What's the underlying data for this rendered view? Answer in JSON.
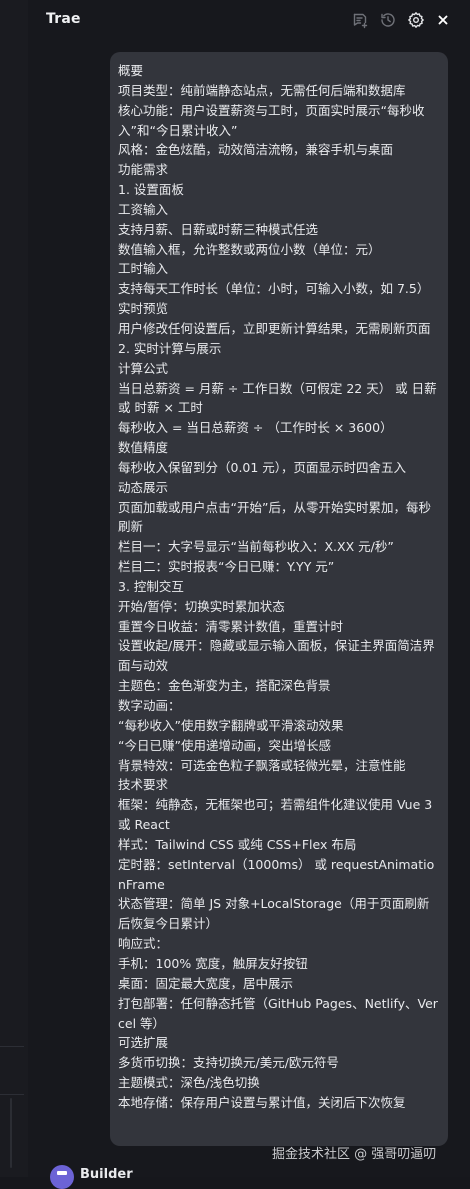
{
  "header": {
    "title": "Trae",
    "icons": [
      "add-chat-icon",
      "history-icon",
      "gear-icon",
      "close-icon"
    ]
  },
  "message": {
    "lines": [
      "概要",
      "项目类型：纯前端静态站点，无需任何后端和数据库",
      "核心功能：用户设置薪资与工时，页面实时展示“每秒收入”和“今日累计收入”",
      "风格：金色炫酷，动效简洁流畅，兼容手机与桌面",
      "功能需求",
      "1. 设置面板",
      "工资输入",
      "支持月薪、日薪或时薪三种模式任选",
      "数值输入框，允许整数或两位小数（单位：元）",
      "工时输入",
      "支持每天工作时长（单位：小时，可输入小数，如 7.5）",
      "实时预览",
      "用户修改任何设置后，立即更新计算结果，无需刷新页面",
      "2. 实时计算与展示",
      "计算公式",
      "当日总薪资 = 月薪 ÷ 工作日数（可假定 22 天） 或  日薪 或  时薪 × 工时",
      "每秒收入 = 当日总薪资 ÷ （工作时长 × 3600）",
      "数值精度",
      "每秒收入保留到分（0.01 元），页面显示时四舍五入",
      "动态展示",
      "页面加载或用户点击“开始”后，从零开始实时累加，每秒刷新",
      "栏目一：大字号显示“当前每秒收入：X.XX 元/秒”",
      "栏目二：实时报表“今日已赚：Y.YY 元”",
      "3. 控制交互",
      "开始/暂停：切换实时累加状态",
      "重置今日收益：清零累计数值，重置计时",
      "设置收起/展开：隐藏或显示输入面板，保证主界面简洁界面与动效",
      "主题色：金色渐变为主，搭配深色背景",
      "数字动画：",
      "“每秒收入”使用数字翻牌或平滑滚动效果",
      "“今日已赚”使用递增动画，突出增长感",
      "背景特效：可选金色粒子飘落或轻微光晕，注意性能",
      "技术要求",
      "框架：纯静态，无框架也可；若需组件化建议使用 Vue 3 或 React",
      "样式：Tailwind CSS 或纯 CSS+Flex 布局",
      "定时器：setInterval（1000ms） 或 requestAnimationFrame",
      "状态管理：简单 JS 对象+LocalStorage（用于页面刷新后恢复今日累计）",
      "响应式：",
      "手机：100% 宽度，触屏友好按钮",
      "桌面：固定最大宽度，居中展示",
      "打包部署：任何静态托管（GitHub Pages、Netlify、Vercel 等）",
      "可选扩展",
      "多货币切换：支持切换元/美元/欧元符号",
      "主题模式：深色/浅色切换",
      "本地存储：保存用户设置与累计值，关闭后下次恢复"
    ]
  },
  "watermark": "掘金技术社区 @ 强哥叨逼叨",
  "footer": {
    "sender_name": "Builder"
  }
}
